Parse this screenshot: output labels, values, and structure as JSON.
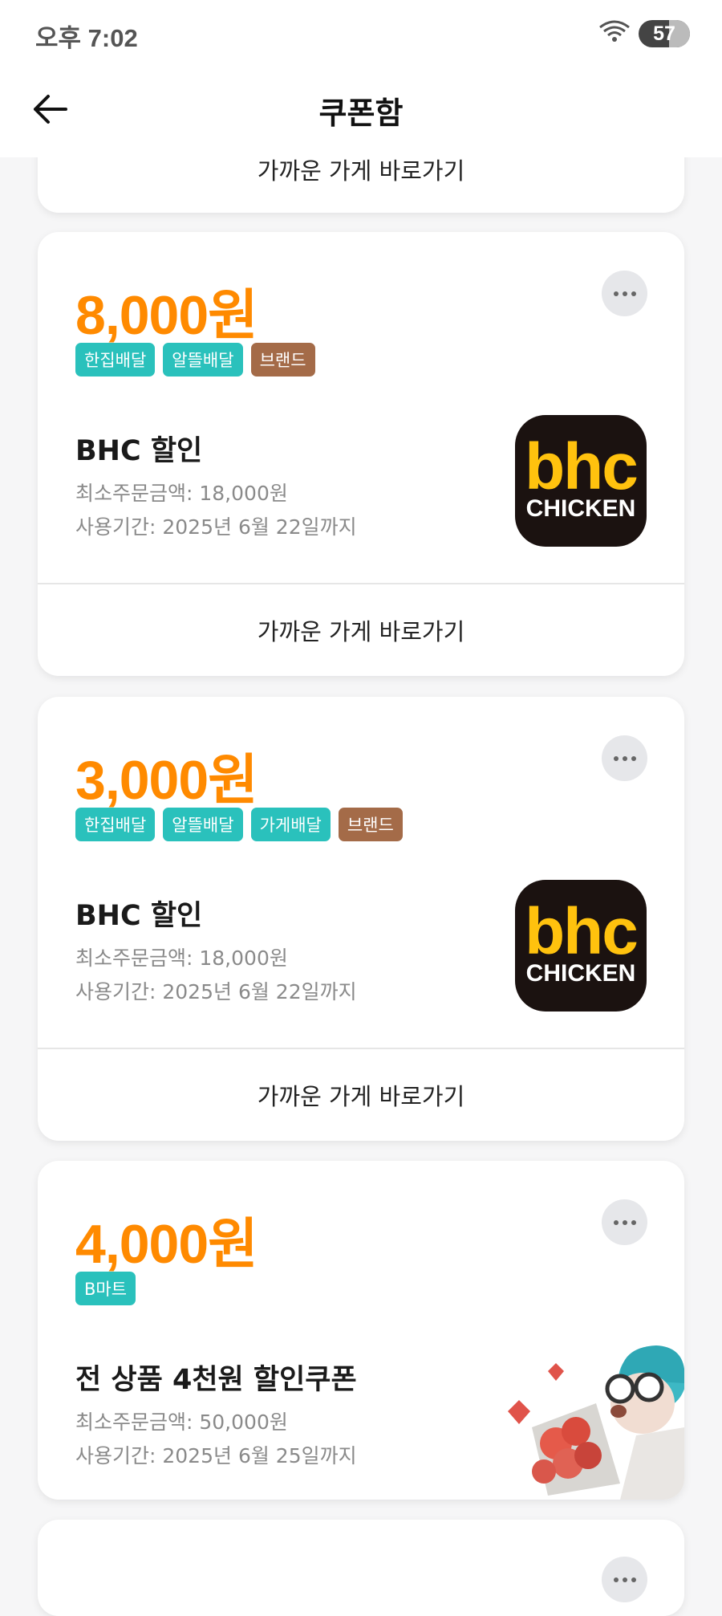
{
  "status": {
    "time": "오후 7:02",
    "battery": "57"
  },
  "header": {
    "title": "쿠폰함"
  },
  "partial_top_card": {
    "link": "가까운 가게 바로가기"
  },
  "coupons": [
    {
      "amount": "8,000원",
      "tags": [
        "한집배달",
        "알뜰배달"
      ],
      "brand_tag": "브랜드",
      "name": "BHC 할인",
      "min_order": "최소주문금액: 18,000원",
      "period": "사용기간: 2025년 6월 22일까지",
      "logo_top": "bhc",
      "logo_bottom": "CHICKEN",
      "link": "가까운 가게 바로가기"
    },
    {
      "amount": "3,000원",
      "tags": [
        "한집배달",
        "알뜰배달",
        "가게배달"
      ],
      "brand_tag": "브랜드",
      "name": "BHC 할인",
      "min_order": "최소주문금액: 18,000원",
      "period": "사용기간: 2025년 6월 22일까지",
      "logo_top": "bhc",
      "logo_bottom": "CHICKEN",
      "link": "가까운 가게 바로가기"
    },
    {
      "amount": "4,000원",
      "tags": [
        "B마트"
      ],
      "name": "전 상품 4천원 할인쿠폰",
      "min_order": "최소주문금액: 50,000원",
      "period": "사용기간: 2025년 6월 25일까지"
    }
  ],
  "colors": {
    "accent": "#FF8A00",
    "tag": "#2AC1BC",
    "brand_tag": "#A46B48"
  }
}
